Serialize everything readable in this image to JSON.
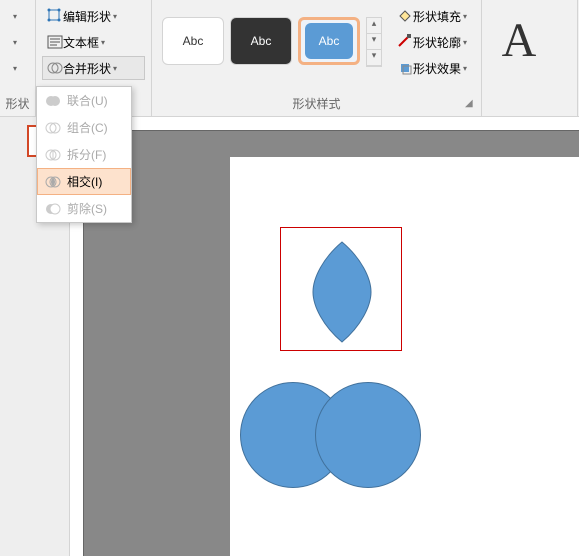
{
  "ribbon": {
    "insertShapes": {
      "label": "形状"
    },
    "editShape": "编辑形状",
    "textBox": "文本框",
    "mergeShapes": "合并形状",
    "shapeStyles": {
      "label": "形状样式",
      "abc": "Abc"
    },
    "shapeFill": "形状填充",
    "shapeOutline": "形状轮廓",
    "shapeEffects": "形状效果"
  },
  "dropdown": {
    "union": "联合(U)",
    "combine": "组合(C)",
    "fragment": "拆分(F)",
    "intersect": "相交(I)",
    "subtract": "剪除(S)"
  }
}
